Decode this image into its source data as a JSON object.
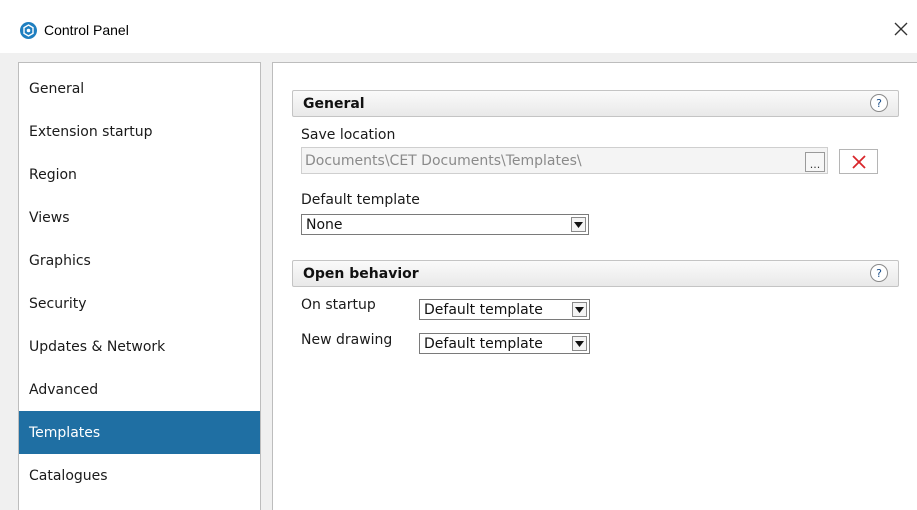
{
  "window": {
    "title": "Control Panel",
    "close_glyph": "✕",
    "icon": "app-logo-icon",
    "accent_color": "#1f6fa3"
  },
  "sidebar": {
    "items": [
      {
        "label": "General",
        "active": false
      },
      {
        "label": "Extension startup",
        "active": false
      },
      {
        "label": "Region",
        "active": false
      },
      {
        "label": "Views",
        "active": false
      },
      {
        "label": "Graphics",
        "active": false
      },
      {
        "label": "Security",
        "active": false
      },
      {
        "label": "Updates & Network",
        "active": false
      },
      {
        "label": "Advanced",
        "active": false
      },
      {
        "label": "Templates",
        "active": true
      },
      {
        "label": "Catalogues",
        "active": false
      }
    ]
  },
  "main": {
    "general_section": {
      "title": "General",
      "help_glyph": "?",
      "save_location_label": "Save location",
      "save_location_value": "Documents\\CET Documents\\Templates\\",
      "browse_label": "...",
      "default_template_label": "Default template",
      "default_template_value": "None"
    },
    "open_behavior_section": {
      "title": "Open behavior",
      "help_glyph": "?",
      "on_startup_label": "On startup",
      "on_startup_value": "Default template",
      "new_drawing_label": "New drawing",
      "new_drawing_value": "Default template"
    }
  }
}
